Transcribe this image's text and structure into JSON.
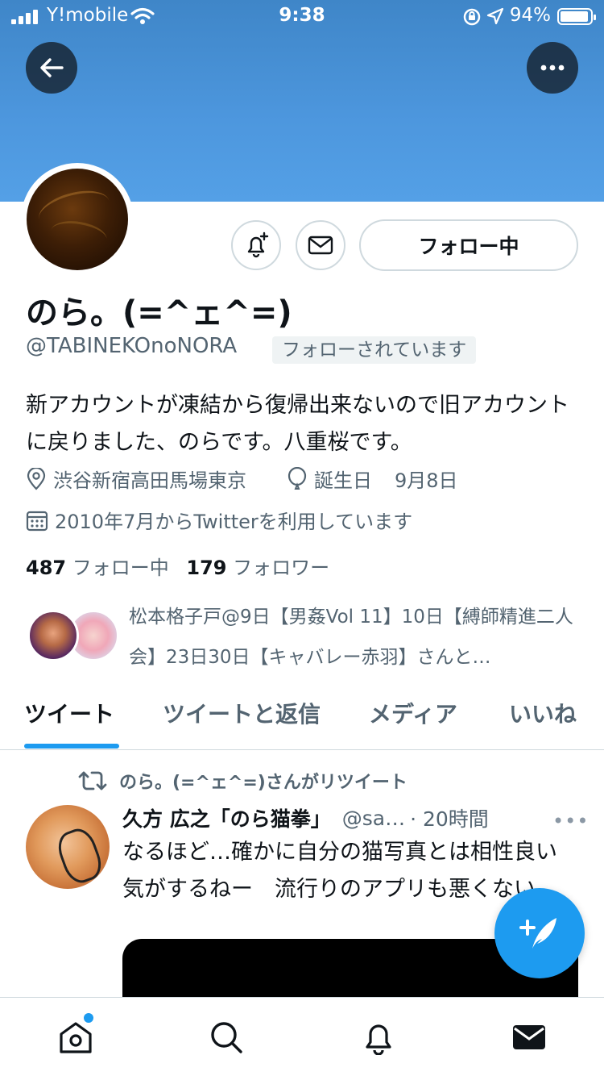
{
  "status_bar": {
    "carrier": "Y!mobile",
    "time": "9:38",
    "battery": "94%",
    "battery_level": 0.94
  },
  "profile": {
    "display_name": "のら。(=^ェ^=)",
    "handle": "@TABINEKOnoNORA",
    "follows_you_badge": "フォローされています",
    "follow_button": "フォロー中",
    "bio": "新アカウントが凍結から復帰出来ないので旧アカウントに戻りました、のらです。八重桜です。",
    "location": "渋谷新宿高田馬場東京",
    "birthday_label": "誕生日",
    "birthday": "9月8日",
    "joined": "2010年7月からTwitterを利用しています",
    "following_count": "487",
    "following_label": "フォロー中",
    "followers_count": "179",
    "followers_label": "フォロワー",
    "followed_by": "松本格子戸@9日【男姦Vol 11】10日【縛師精進二人会】23日30日【キャバレー赤羽】さんと…"
  },
  "tabs": [
    {
      "label": "ツイート",
      "active": true
    },
    {
      "label": "ツイートと返信",
      "active": false
    },
    {
      "label": "メディア",
      "active": false
    },
    {
      "label": "いいね",
      "active": false
    }
  ],
  "tweet": {
    "retweeted_by": "のら。(=^ェ^=)さんがリツイート",
    "author": "久方 広之「のら猫拳」",
    "handle": "@sa…",
    "time": "· 20時間",
    "more": "•••",
    "text": "なるほど…確かに自分の猫写真とは相性良い気がするねー　流行りのアプリも悪くない"
  },
  "icons": {
    "back": "back-arrow-icon",
    "more": "more-icon",
    "notify": "bell-plus-icon",
    "message": "envelope-icon",
    "location": "location-pin-icon",
    "birthday": "balloon-icon",
    "calendar": "calendar-icon",
    "retweet": "retweet-icon",
    "compose": "compose-tweet-icon",
    "home": "home-icon",
    "search": "search-icon",
    "notifications": "bell-icon",
    "messages": "mail-icon"
  },
  "colors": {
    "accent": "#1d9bf0",
    "banner": "#4d97de",
    "secondary_text": "#536471"
  }
}
